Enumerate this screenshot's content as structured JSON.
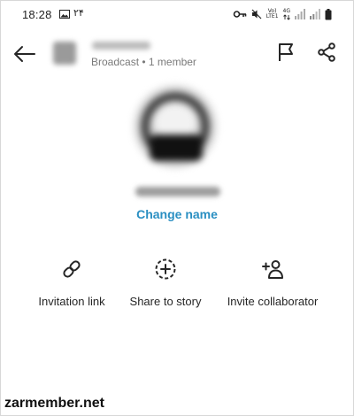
{
  "status_bar": {
    "time": "18:28",
    "extra": "۲۴",
    "network_type_top": "Vo)",
    "network_type_bottom": "LTE1",
    "network_gen": "4G"
  },
  "header": {
    "subtitle": "Broadcast • 1 member"
  },
  "profile": {
    "change_name_label": "Change name",
    "accent_color": "#2a8fc2"
  },
  "actions": {
    "invitation_link": "Invitation link",
    "share_to_story": "Share to story",
    "invite_collaborator": "Invite collaborator"
  },
  "watermark": "zarmember.net"
}
